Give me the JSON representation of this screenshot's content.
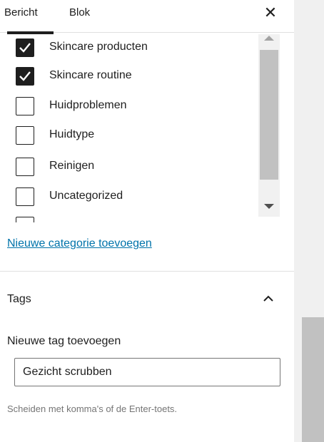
{
  "tabs": [
    {
      "label": "Bericht",
      "active": true
    },
    {
      "label": "Blok",
      "active": false
    }
  ],
  "close_icon": "close-icon",
  "categories": [
    {
      "label": "Skincare producten",
      "checked": true
    },
    {
      "label": "Skincare routine",
      "checked": true
    },
    {
      "label": "Huidproblemen",
      "checked": false
    },
    {
      "label": "Huidtype",
      "checked": false
    },
    {
      "label": "Reinigen",
      "checked": false
    },
    {
      "label": "Uncategorized",
      "checked": false
    }
  ],
  "add_category_link": "Nieuwe categorie toevoegen",
  "tags": {
    "title": "Tags",
    "toggle_icon": "chevron-up-icon",
    "new_tag_label": "Nieuwe tag toevoegen",
    "input_value": "Gezicht scrubben",
    "help_text": "Scheiden met komma's of de Enter-toets."
  },
  "colors": {
    "text": "#1e1e1e",
    "link": "#0073aa",
    "muted": "#757575",
    "checkbox_checked": "#1e1e1e"
  }
}
